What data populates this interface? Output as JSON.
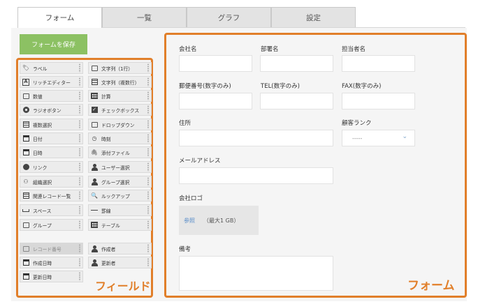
{
  "tabs": [
    {
      "label": "フォーム",
      "active": true
    },
    {
      "label": "一覧",
      "active": false
    },
    {
      "label": "グラフ",
      "active": false
    },
    {
      "label": "設定",
      "active": false
    }
  ],
  "toolbar": {
    "save_label": "フォームを保存"
  },
  "palette": {
    "caption": "フィールド",
    "items": [
      {
        "label": "ラベル",
        "icon": "tag-icon"
      },
      {
        "label": "文字列（1行）",
        "icon": "single-line-text-icon"
      },
      {
        "label": "リッチエディター",
        "icon": "rich-text-icon"
      },
      {
        "label": "文字列（複数行）",
        "icon": "multi-line-text-icon"
      },
      {
        "label": "数値",
        "icon": "number-icon"
      },
      {
        "label": "計算",
        "icon": "calculator-icon"
      },
      {
        "label": "ラジオボタン",
        "icon": "radio-icon"
      },
      {
        "label": "チェックボックス",
        "icon": "checkbox-icon"
      },
      {
        "label": "複数選択",
        "icon": "multi-select-icon"
      },
      {
        "label": "ドロップダウン",
        "icon": "dropdown-icon"
      },
      {
        "label": "日付",
        "icon": "calendar-icon"
      },
      {
        "label": "時刻",
        "icon": "clock-icon"
      },
      {
        "label": "日時",
        "icon": "datetime-icon"
      },
      {
        "label": "添付ファイル",
        "icon": "attachment-icon"
      },
      {
        "label": "リンク",
        "icon": "globe-icon"
      },
      {
        "label": "ユーザー選択",
        "icon": "user-icon"
      },
      {
        "label": "組織選択",
        "icon": "organization-icon"
      },
      {
        "label": "グループ選択",
        "icon": "group-icon"
      },
      {
        "label": "関連レコード一覧",
        "icon": "related-records-icon"
      },
      {
        "label": "ルックアップ",
        "icon": "lookup-icon"
      },
      {
        "label": "スペース",
        "icon": "space-icon"
      },
      {
        "label": "罫線",
        "icon": "border-line-icon"
      },
      {
        "label": "グループ",
        "icon": "group-field-icon"
      },
      {
        "label": "テーブル",
        "icon": "table-icon"
      }
    ],
    "system_items": [
      {
        "label": "レコード番号",
        "icon": "record-number-icon",
        "disabled": true
      },
      {
        "label": "作成者",
        "icon": "creator-icon",
        "disabled": false
      },
      {
        "label": "作成日時",
        "icon": "created-datetime-icon",
        "disabled": false
      },
      {
        "label": "更新者",
        "icon": "updater-icon",
        "disabled": false
      },
      {
        "label": "更新日時",
        "icon": "updated-datetime-icon",
        "disabled": false
      }
    ]
  },
  "form": {
    "caption": "フォーム",
    "company": "会社名",
    "department": "部署名",
    "person": "担当者名",
    "postal": "郵便番号(数字のみ)",
    "tel": "TEL(数字のみ)",
    "fax": "FAX(数字のみ)",
    "address": "住所",
    "rank": "顧客ランク",
    "rank_value": "-----",
    "email": "メールアドレス",
    "logo": "会社ロゴ",
    "browse": "参照",
    "limit": "（最大1 GB）",
    "notes": "備考"
  },
  "colors": {
    "accent": "#e17f2a",
    "save_button": "#8cc163"
  }
}
